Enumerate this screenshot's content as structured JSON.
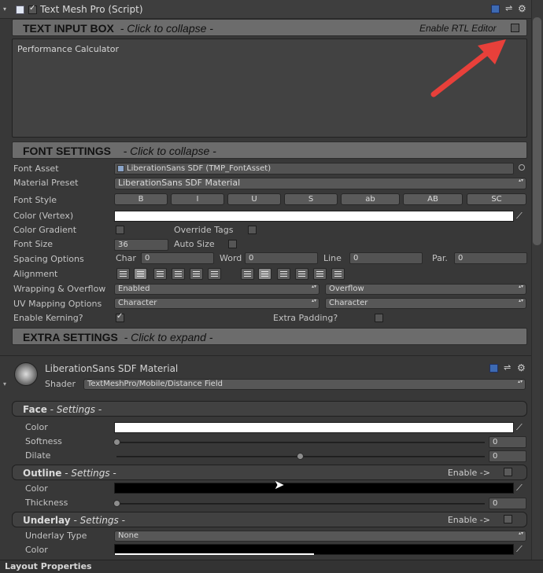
{
  "component": {
    "title": "Text Mesh Pro (Script)",
    "enabled": true
  },
  "text_input": {
    "header_title": "TEXT INPUT BOX",
    "header_hint": "- Click to collapse -",
    "rtl_label": "Enable RTL Editor",
    "rtl_enabled": false,
    "text": "Performance Calculator"
  },
  "font_settings": {
    "header_title": "FONT SETTINGS",
    "header_hint": "- Click to collapse -",
    "font_asset_label": "Font Asset",
    "font_asset_value": "LiberationSans SDF (TMP_FontAsset)",
    "material_preset_label": "Material Preset",
    "material_preset_value": "LiberationSans SDF Material",
    "font_style_label": "Font Style",
    "style_buttons": [
      "B",
      "I",
      "U",
      "S",
      "ab",
      "AB",
      "SC"
    ],
    "color_label": "Color (Vertex)",
    "color_value": "#ffffff",
    "gradient_label": "Color Gradient",
    "override_tags_label": "Override Tags",
    "font_size_label": "Font Size",
    "font_size_value": "36",
    "auto_size_label": "Auto Size",
    "spacing_label": "Spacing Options",
    "spacing": {
      "char_label": "Char",
      "char_value": "0",
      "word_label": "Word",
      "word_value": "0",
      "line_label": "Line",
      "line_value": "0",
      "par_label": "Par.",
      "par_value": "0"
    },
    "alignment_label": "Alignment",
    "wrapping_label": "Wrapping & Overflow",
    "wrapping_value": "Enabled",
    "overflow_value": "Overflow",
    "uv_label": "UV Mapping Options",
    "uv_h_value": "Character",
    "uv_v_value": "Character",
    "kerning_label": "Enable Kerning?",
    "kerning_enabled": true,
    "extra_padding_label": "Extra Padding?",
    "extra_padding_enabled": false
  },
  "extra_settings": {
    "header_title": "EXTRA SETTINGS",
    "header_hint": "- Click to expand -"
  },
  "material": {
    "name": "LiberationSans SDF Material",
    "shader_label": "Shader",
    "shader_value": "TextMeshPro/Mobile/Distance Field",
    "face": {
      "title": "Face",
      "subtitle": "- Settings -",
      "color_label": "Color",
      "color_value": "#ffffff",
      "softness_label": "Softness",
      "softness_value": "0",
      "softness_fraction": 0.0,
      "dilate_label": "Dilate",
      "dilate_value": "0",
      "dilate_fraction": 0.5
    },
    "outline": {
      "title": "Outline",
      "subtitle": "- Settings -",
      "enable_label": "Enable ->",
      "color_label": "Color",
      "color_value": "#000000",
      "thickness_label": "Thickness",
      "thickness_value": "0",
      "thickness_fraction": 0.0
    },
    "underlay": {
      "title": "Underlay",
      "subtitle": "- Settings -",
      "enable_label": "Enable ->",
      "type_label": "Underlay Type",
      "type_value": "None",
      "color_label": "Color",
      "color_value": "#000000"
    }
  },
  "footer": {
    "label": "Layout Properties"
  },
  "colors": {
    "accent_arrow": "#e8403a",
    "section_bar": "#6c6c6c",
    "background": "#383838"
  }
}
